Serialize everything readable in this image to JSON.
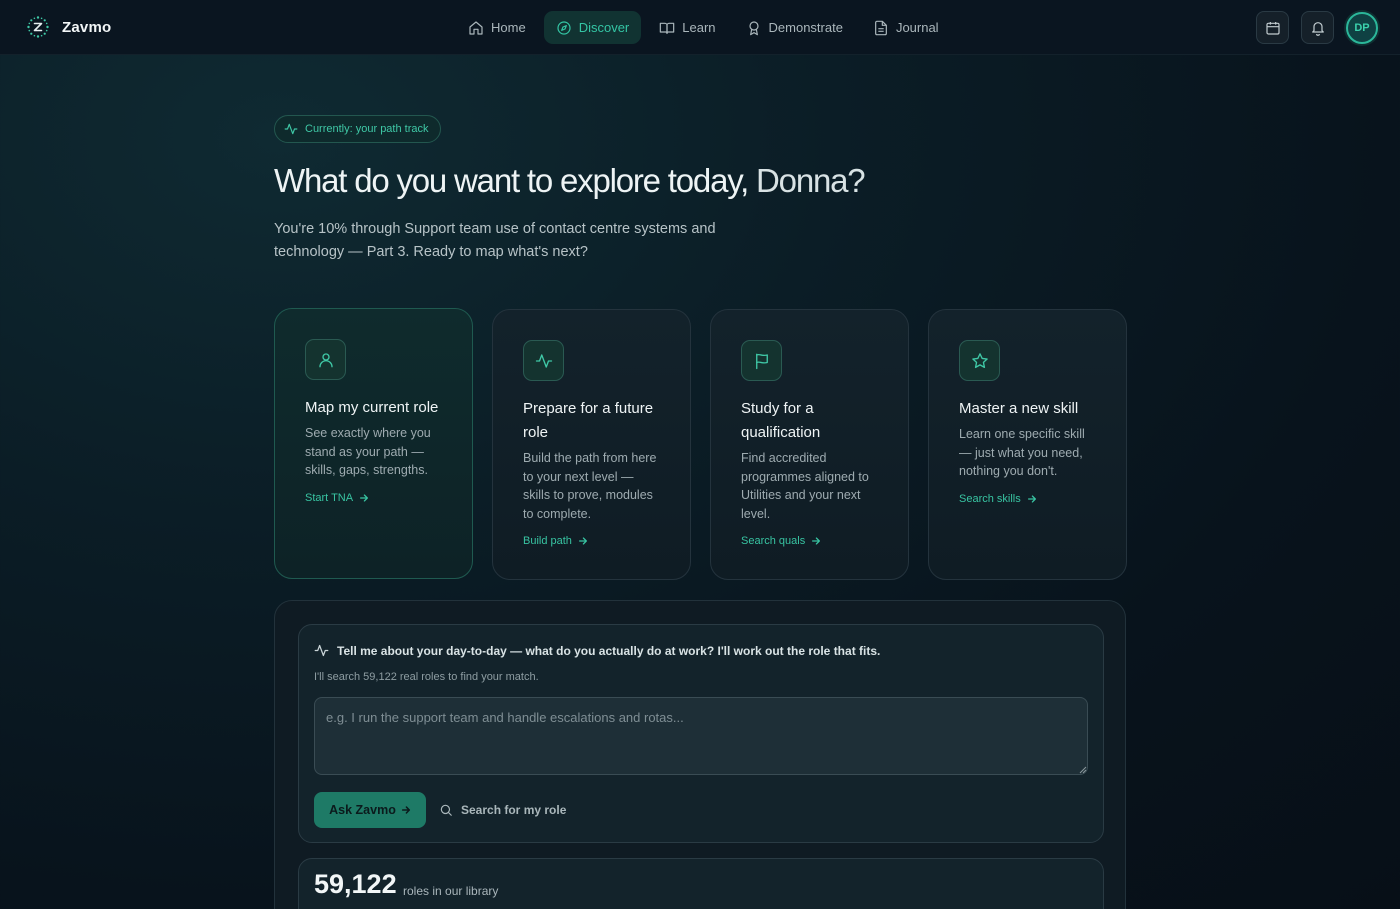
{
  "brand": {
    "name": "Zavmo"
  },
  "nav": {
    "items": [
      {
        "label": "Home",
        "icon": "home-icon",
        "active": false
      },
      {
        "label": "Discover",
        "icon": "compass-icon",
        "active": true
      },
      {
        "label": "Learn",
        "icon": "book-icon",
        "active": false
      },
      {
        "label": "Demonstrate",
        "icon": "award-icon",
        "active": false
      },
      {
        "label": "Journal",
        "icon": "document-icon",
        "active": false
      }
    ],
    "avatar_initials": "DP"
  },
  "hero": {
    "badge": "Currently: your path track",
    "title_prefix": "What do you want to explore today, ",
    "title_name": "Donna?",
    "subtitle": "You're 10% through Support team use of contact centre systems and technology — Part 3. Ready to map what's next?"
  },
  "cards": [
    {
      "title": "Map my current role",
      "desc": "See exactly where you stand as your path — skills, gaps, strengths.",
      "cta": "Start TNA",
      "icon": "user-icon"
    },
    {
      "title": "Prepare for a future role",
      "desc": "Build the path from here to your next level — skills to prove, modules to complete.",
      "cta": "Build path",
      "icon": "activity-icon"
    },
    {
      "title": "Study for a qualification",
      "desc": "Find accredited programmes aligned to Utilities and your next level.",
      "cta": "Search quals",
      "icon": "flag-icon"
    },
    {
      "title": "Master a new skill",
      "desc": "Learn one specific skill — just what you need, nothing you don't.",
      "cta": "Search skills",
      "icon": "star-icon"
    }
  ],
  "ask": {
    "question": "Tell me about your day-to-day — what do you actually do at work? I'll work out the role that fits.",
    "hint": "I'll search 59,122 real roles to find your match.",
    "placeholder": "e.g. I run the support team and handle escalations and rotas...",
    "button": "Ask Zavmo",
    "search_label": "Search for my role"
  },
  "stats": {
    "count": "59,122",
    "label": "roles in our library"
  },
  "colors": {
    "accent": "#34c5a4",
    "background": "#0b1d26",
    "button": "#1e7a66"
  }
}
